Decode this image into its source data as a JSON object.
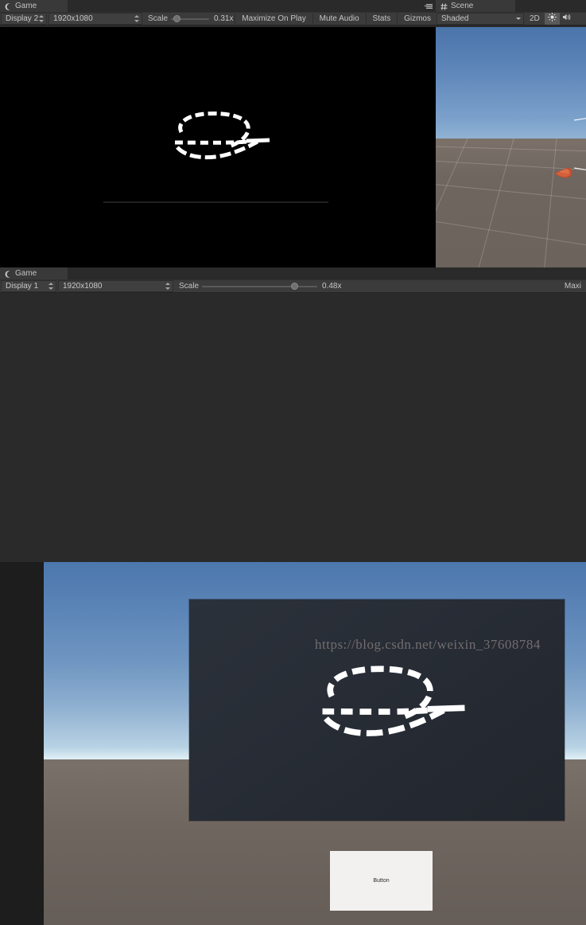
{
  "views": {
    "game_top": {
      "tab": {
        "label": "Game",
        "icon": "game-controller-icon"
      },
      "menu_icon": "panel-options-icon",
      "toolbar": {
        "display": "Display 2",
        "resolution": "1920x1080",
        "scale_label": "Scale",
        "scale_value": "0.31x",
        "scale_percent": 8,
        "maximize_on_play": "Maximize On Play",
        "mute_audio": "Mute Audio",
        "stats": "Stats",
        "gizmos": "Gizmos"
      },
      "canvas": {
        "background_color": "#000000",
        "drawing": "hand-drawn-lasso-loop",
        "stroke_color": "#ffffff"
      }
    },
    "scene": {
      "tab": {
        "label": "Scene",
        "icon": "scene-grid-icon"
      },
      "toolbar": {
        "draw_mode": "Shaded",
        "view_2d": "2D",
        "lighting_icon": "sun-icon",
        "audio_icon": "speaker-icon"
      },
      "canvas": {
        "sky_color": "#5e86b9",
        "ground_color": "#6f665f",
        "object_color": "#c1502f",
        "object_name": "cone-object",
        "gizmo_name": "camera-frustum-wireframe"
      }
    },
    "game_bottom": {
      "tab": {
        "label": "Game",
        "icon": "game-controller-icon"
      },
      "toolbar": {
        "display": "Display 1",
        "resolution": "1920x1080",
        "scale_label": "Scale",
        "scale_value": "0.48x",
        "scale_percent": 82,
        "maximize_on_play": "Maxi"
      },
      "canvas": {
        "sky_color": "#5a83b6",
        "ground_color": "#6f665f",
        "quad_color": "#272c35",
        "drawing": "hand-drawn-lasso-loop",
        "stroke_color": "#ffffff"
      },
      "ui_button": {
        "label": "Button",
        "background": "#f2f1ef",
        "text_color": "#2b2b2b"
      }
    }
  },
  "watermark": {
    "text": "https://blog.csdn.net/weixin_37608784"
  }
}
